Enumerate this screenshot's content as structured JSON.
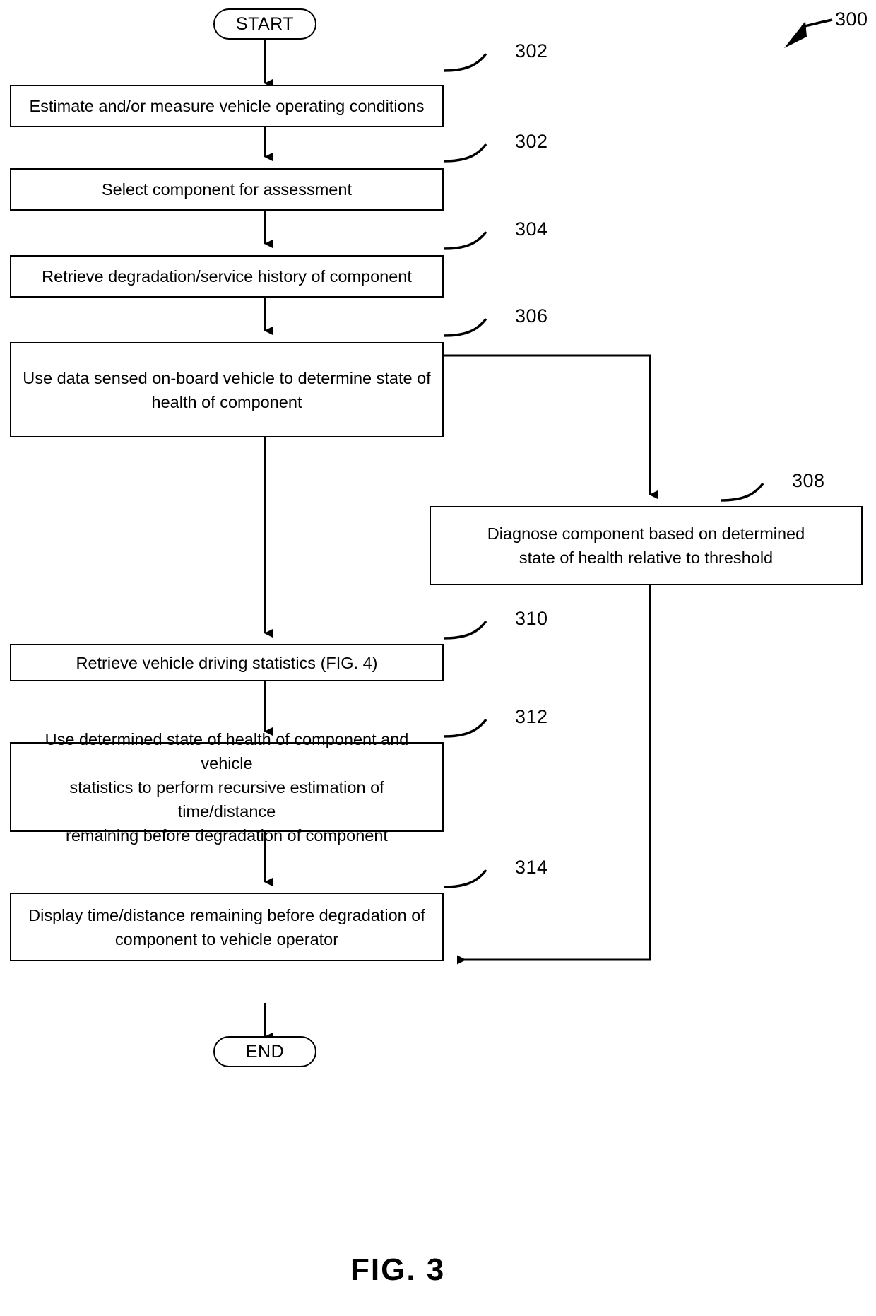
{
  "figure": {
    "caption": "FIG. 3",
    "diagram_ref": "300"
  },
  "nodes": {
    "start": {
      "label": "START",
      "ref": ""
    },
    "step_302a": {
      "label": "Estimate and/or measure vehicle operating conditions",
      "ref": "302"
    },
    "step_302b": {
      "label": "Select component for assessment",
      "ref": "302"
    },
    "step_304": {
      "label": "Retrieve degradation/service history of component",
      "ref": "304"
    },
    "step_306": {
      "label": "Use data sensed on-board vehicle to determine state of\nhealth of component",
      "ref": "306"
    },
    "step_308": {
      "label": "Diagnose component based on determined\nstate of health relative to threshold",
      "ref": "308"
    },
    "step_310": {
      "label": "Retrieve vehicle driving statistics (FIG. 4)",
      "ref": "310"
    },
    "step_312": {
      "label": "Use determined state of health of component and vehicle\nstatistics to perform recursive estimation of time/distance\nremaining before degradation of component",
      "ref": "312"
    },
    "step_314": {
      "label": "Display time/distance remaining before degradation of\ncomponent to vehicle operator",
      "ref": "314"
    },
    "end": {
      "label": "END",
      "ref": ""
    }
  },
  "style": {
    "line_color": "#000000",
    "background": "#ffffff"
  }
}
